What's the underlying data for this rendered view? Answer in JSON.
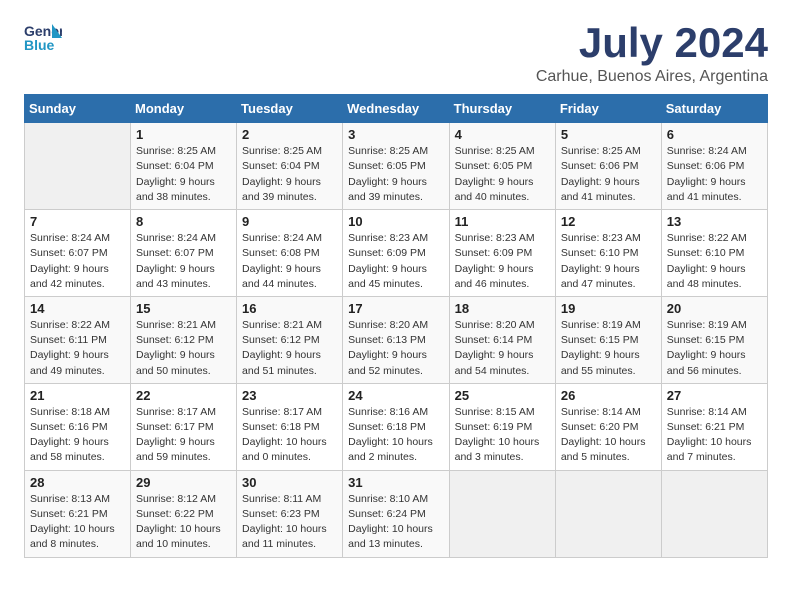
{
  "logo": {
    "general": "General",
    "blue": "Blue"
  },
  "title": "July 2024",
  "subtitle": "Carhue, Buenos Aires, Argentina",
  "days_of_week": [
    "Sunday",
    "Monday",
    "Tuesday",
    "Wednesday",
    "Thursday",
    "Friday",
    "Saturday"
  ],
  "weeks": [
    [
      {
        "day": "",
        "detail": ""
      },
      {
        "day": "1",
        "detail": "Sunrise: 8:25 AM\nSunset: 6:04 PM\nDaylight: 9 hours\nand 38 minutes."
      },
      {
        "day": "2",
        "detail": "Sunrise: 8:25 AM\nSunset: 6:04 PM\nDaylight: 9 hours\nand 39 minutes."
      },
      {
        "day": "3",
        "detail": "Sunrise: 8:25 AM\nSunset: 6:05 PM\nDaylight: 9 hours\nand 39 minutes."
      },
      {
        "day": "4",
        "detail": "Sunrise: 8:25 AM\nSunset: 6:05 PM\nDaylight: 9 hours\nand 40 minutes."
      },
      {
        "day": "5",
        "detail": "Sunrise: 8:25 AM\nSunset: 6:06 PM\nDaylight: 9 hours\nand 41 minutes."
      },
      {
        "day": "6",
        "detail": "Sunrise: 8:24 AM\nSunset: 6:06 PM\nDaylight: 9 hours\nand 41 minutes."
      }
    ],
    [
      {
        "day": "7",
        "detail": "Sunrise: 8:24 AM\nSunset: 6:07 PM\nDaylight: 9 hours\nand 42 minutes."
      },
      {
        "day": "8",
        "detail": "Sunrise: 8:24 AM\nSunset: 6:07 PM\nDaylight: 9 hours\nand 43 minutes."
      },
      {
        "day": "9",
        "detail": "Sunrise: 8:24 AM\nSunset: 6:08 PM\nDaylight: 9 hours\nand 44 minutes."
      },
      {
        "day": "10",
        "detail": "Sunrise: 8:23 AM\nSunset: 6:09 PM\nDaylight: 9 hours\nand 45 minutes."
      },
      {
        "day": "11",
        "detail": "Sunrise: 8:23 AM\nSunset: 6:09 PM\nDaylight: 9 hours\nand 46 minutes."
      },
      {
        "day": "12",
        "detail": "Sunrise: 8:23 AM\nSunset: 6:10 PM\nDaylight: 9 hours\nand 47 minutes."
      },
      {
        "day": "13",
        "detail": "Sunrise: 8:22 AM\nSunset: 6:10 PM\nDaylight: 9 hours\nand 48 minutes."
      }
    ],
    [
      {
        "day": "14",
        "detail": "Sunrise: 8:22 AM\nSunset: 6:11 PM\nDaylight: 9 hours\nand 49 minutes."
      },
      {
        "day": "15",
        "detail": "Sunrise: 8:21 AM\nSunset: 6:12 PM\nDaylight: 9 hours\nand 50 minutes."
      },
      {
        "day": "16",
        "detail": "Sunrise: 8:21 AM\nSunset: 6:12 PM\nDaylight: 9 hours\nand 51 minutes."
      },
      {
        "day": "17",
        "detail": "Sunrise: 8:20 AM\nSunset: 6:13 PM\nDaylight: 9 hours\nand 52 minutes."
      },
      {
        "day": "18",
        "detail": "Sunrise: 8:20 AM\nSunset: 6:14 PM\nDaylight: 9 hours\nand 54 minutes."
      },
      {
        "day": "19",
        "detail": "Sunrise: 8:19 AM\nSunset: 6:15 PM\nDaylight: 9 hours\nand 55 minutes."
      },
      {
        "day": "20",
        "detail": "Sunrise: 8:19 AM\nSunset: 6:15 PM\nDaylight: 9 hours\nand 56 minutes."
      }
    ],
    [
      {
        "day": "21",
        "detail": "Sunrise: 8:18 AM\nSunset: 6:16 PM\nDaylight: 9 hours\nand 58 minutes."
      },
      {
        "day": "22",
        "detail": "Sunrise: 8:17 AM\nSunset: 6:17 PM\nDaylight: 9 hours\nand 59 minutes."
      },
      {
        "day": "23",
        "detail": "Sunrise: 8:17 AM\nSunset: 6:18 PM\nDaylight: 10 hours\nand 0 minutes."
      },
      {
        "day": "24",
        "detail": "Sunrise: 8:16 AM\nSunset: 6:18 PM\nDaylight: 10 hours\nand 2 minutes."
      },
      {
        "day": "25",
        "detail": "Sunrise: 8:15 AM\nSunset: 6:19 PM\nDaylight: 10 hours\nand 3 minutes."
      },
      {
        "day": "26",
        "detail": "Sunrise: 8:14 AM\nSunset: 6:20 PM\nDaylight: 10 hours\nand 5 minutes."
      },
      {
        "day": "27",
        "detail": "Sunrise: 8:14 AM\nSunset: 6:21 PM\nDaylight: 10 hours\nand 7 minutes."
      }
    ],
    [
      {
        "day": "28",
        "detail": "Sunrise: 8:13 AM\nSunset: 6:21 PM\nDaylight: 10 hours\nand 8 minutes."
      },
      {
        "day": "29",
        "detail": "Sunrise: 8:12 AM\nSunset: 6:22 PM\nDaylight: 10 hours\nand 10 minutes."
      },
      {
        "day": "30",
        "detail": "Sunrise: 8:11 AM\nSunset: 6:23 PM\nDaylight: 10 hours\nand 11 minutes."
      },
      {
        "day": "31",
        "detail": "Sunrise: 8:10 AM\nSunset: 6:24 PM\nDaylight: 10 hours\nand 13 minutes."
      },
      {
        "day": "",
        "detail": ""
      },
      {
        "day": "",
        "detail": ""
      },
      {
        "day": "",
        "detail": ""
      }
    ]
  ]
}
